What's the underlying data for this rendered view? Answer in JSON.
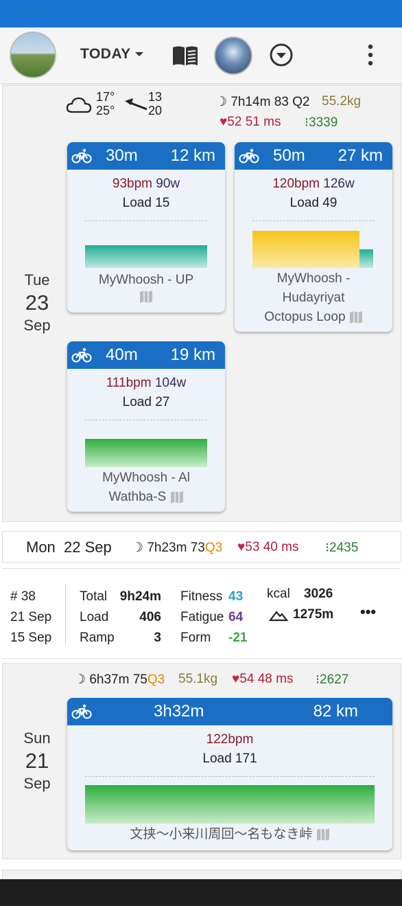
{
  "appbar": {
    "today_label": "TODAY"
  },
  "tue": {
    "dow": "Tue",
    "dnum": "23",
    "mon": "Sep",
    "weather": {
      "temp_high": "17°",
      "temp_low": "25°",
      "wind_a": "13",
      "wind_b": "20"
    },
    "sleep": "7h14m",
    "sleep_score": "83",
    "sleep_quality": "Q2",
    "weight": "55.2kg",
    "rhr": "52",
    "hrv": "51 ms",
    "steps": "3339",
    "activities": [
      {
        "duration": "30m",
        "distance": "12 km",
        "bpm": "93bpm",
        "watts": "90w",
        "load": "Load 15",
        "name": "MyWhoosh - UP"
      },
      {
        "duration": "50m",
        "distance": "27 km",
        "bpm": "120bpm",
        "watts": "126w",
        "load": "Load 49",
        "name_l1": "MyWhoosh -",
        "name_l2": "Hudayriyat",
        "name_l3": "Octopus Loop"
      },
      {
        "duration": "40m",
        "distance": "19 km",
        "bpm": "111bpm",
        "watts": "104w",
        "load": "Load 27",
        "name_l1": "MyWhoosh - Al",
        "name_l2": "Wathba-S"
      }
    ]
  },
  "mon": {
    "label": "Mon",
    "date": "22 Sep",
    "sleep": "7h23m",
    "sleep_score": "73",
    "sleep_quality": "Q3",
    "rhr": "53",
    "hrv": "40 ms",
    "steps": "2435"
  },
  "week": {
    "num": "# 38",
    "end": "21 Sep",
    "start": "15 Sep",
    "total_label": "Total",
    "total": "9h24m",
    "load_label": "Load",
    "load": "406",
    "ramp_label": "Ramp",
    "ramp": "3",
    "fitness_label": "Fitness",
    "fitness": "43",
    "fatigue_label": "Fatigue",
    "fatigue": "64",
    "form_label": "Form",
    "form": "-21",
    "kcal_label": "kcal",
    "kcal": "3026",
    "elev": "1275m",
    "more": "•••"
  },
  "sun": {
    "dow": "Sun",
    "dnum": "21",
    "mon": "Sep",
    "sleep": "6h37m",
    "sleep_score": "75",
    "sleep_quality": "Q3",
    "weight": "55.1kg",
    "rhr": "54",
    "hrv": "48 ms",
    "steps": "2627",
    "activity": {
      "duration": "3h32m",
      "distance": "82 km",
      "bpm": "122bpm",
      "load": "Load 171",
      "name": "文挟〜小来川周回〜名もなき峠"
    }
  },
  "colors": {
    "accent": "#1976d2",
    "card_header": "#1a6fc4",
    "teal": "#26b8a0",
    "green": "#3cb84a",
    "yellow": "#f5c518"
  }
}
